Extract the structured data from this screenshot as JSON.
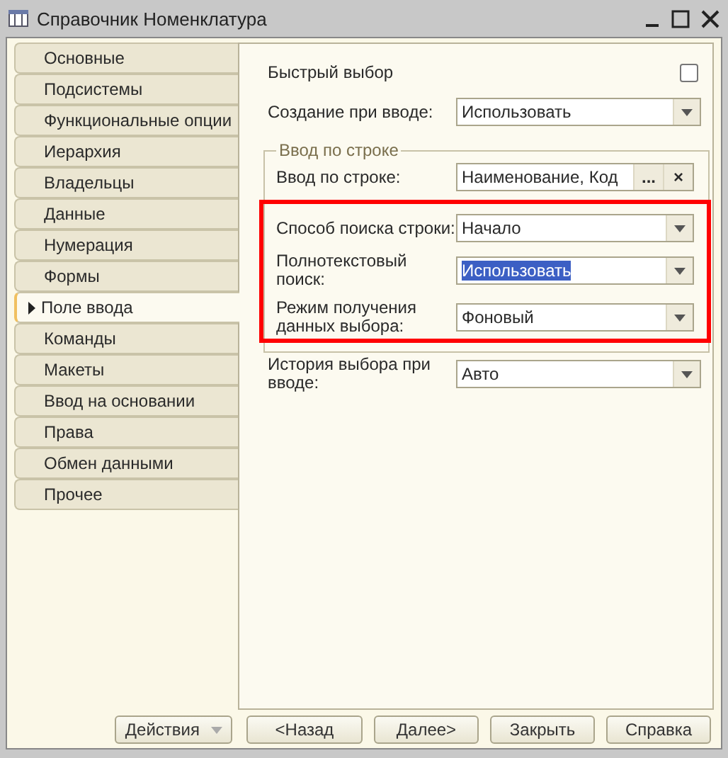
{
  "window": {
    "title": "Справочник Номенклатура"
  },
  "sidebar": {
    "items": [
      {
        "label": "Основные",
        "selected": false
      },
      {
        "label": "Подсистемы",
        "selected": false
      },
      {
        "label": "Функциональные опции",
        "selected": false
      },
      {
        "label": "Иерархия",
        "selected": false
      },
      {
        "label": "Владельцы",
        "selected": false
      },
      {
        "label": "Данные",
        "selected": false
      },
      {
        "label": "Нумерация",
        "selected": false
      },
      {
        "label": "Формы",
        "selected": false
      },
      {
        "label": "Поле ввода",
        "selected": true
      },
      {
        "label": "Команды",
        "selected": false
      },
      {
        "label": "Макеты",
        "selected": false
      },
      {
        "label": "Ввод на основании",
        "selected": false
      },
      {
        "label": "Права",
        "selected": false
      },
      {
        "label": "Обмен данными",
        "selected": false
      },
      {
        "label": "Прочее",
        "selected": false
      }
    ]
  },
  "form": {
    "quick_select": {
      "label": "Быстрый выбор",
      "checked": false
    },
    "create_on_input": {
      "label": "Создание при вводе:",
      "value": "Использовать",
      "text_selected": false
    },
    "group": {
      "title": "Ввод по строке",
      "rows": [
        {
          "label": "Ввод по строке:",
          "kind": "list",
          "value": "Наименование, Код",
          "button": "...",
          "clear": "×",
          "text_selected": false
        }
      ],
      "highlighted_rows": [
        {
          "label": "Способ поиска строки:",
          "kind": "choice",
          "value": "Начало",
          "text_selected": false
        },
        {
          "label": "Полнотекстовый поиск:",
          "kind": "choice",
          "value": "Использовать",
          "text_selected": true
        },
        {
          "label": "Режим получения данных выбора:",
          "kind": "choice",
          "value": "Фоновый",
          "text_selected": false
        }
      ]
    },
    "history": {
      "label": "История выбора при вводе:",
      "value": "Авто",
      "text_selected": false
    }
  },
  "buttons": [
    {
      "label": "Действия",
      "kind": "menu"
    },
    {
      "label": "<Назад",
      "kind": "plain"
    },
    {
      "label": "Далее>",
      "kind": "plain"
    },
    {
      "label": "Закрыть",
      "kind": "plain"
    },
    {
      "label": "Справка",
      "kind": "plain"
    }
  ]
}
